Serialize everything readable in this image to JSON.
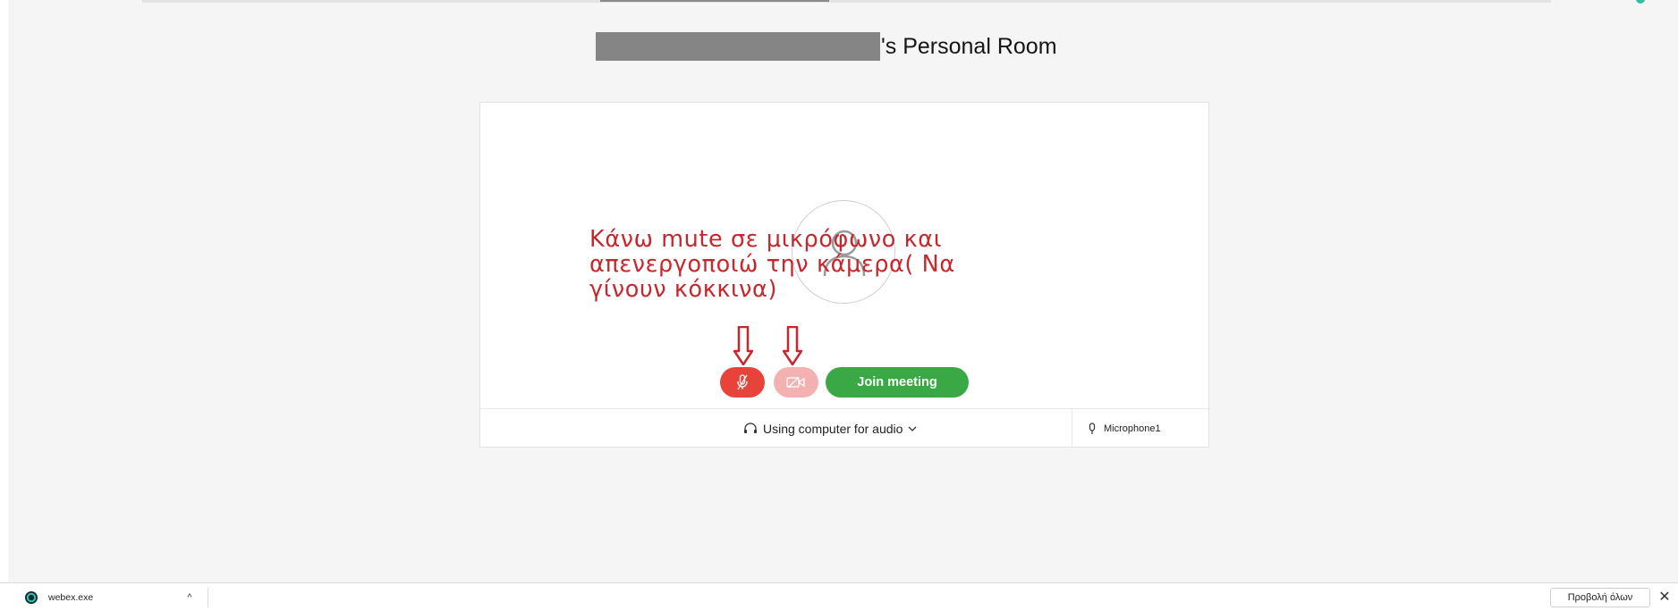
{
  "window": {
    "title_suffix": "'s Personal Room"
  },
  "annotation": {
    "lines": [
      "Κάνω mute σε μικρόφωνο και",
      "απενεργοποιώ την κάμερα( Να",
      "γίνουν κόκκινα)"
    ],
    "color": "#c8262c"
  },
  "preview": {
    "avatar_icon": "person-icon"
  },
  "controls": {
    "mute_icon": "microphone-muted-icon",
    "video_icon": "camera-off-icon",
    "join_label": "Join meeting",
    "mute_color": "#e8433b",
    "video_color": "#f4b1b1",
    "join_color": "#3aa845"
  },
  "footer": {
    "audio_label": "Using computer for audio",
    "audio_icon": "headset-icon",
    "mic_label": "Microphone1",
    "mic_icon": "microphone-icon"
  },
  "download_bar": {
    "file_name": "webex.exe",
    "file_icon": "webex-icon",
    "show_all_label": "Προβολή όλων"
  }
}
